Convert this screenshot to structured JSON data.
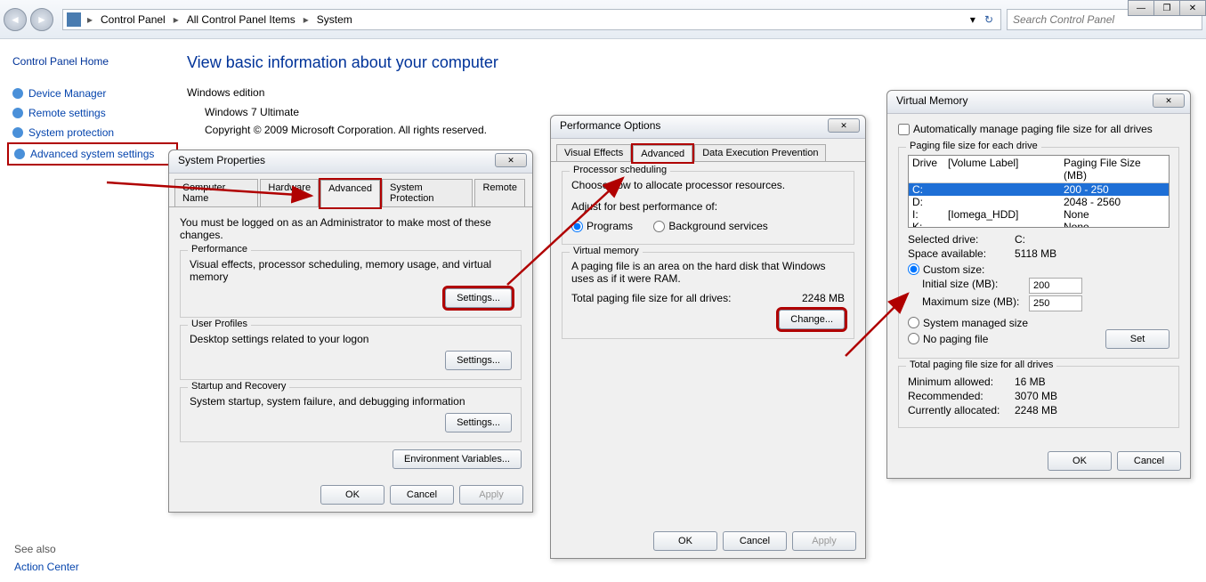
{
  "window_controls": {
    "min": "—",
    "max": "❐",
    "close": "✕"
  },
  "breadcrumb": {
    "items": [
      "Control Panel",
      "All Control Panel Items",
      "System"
    ]
  },
  "search": {
    "placeholder": "Search Control Panel"
  },
  "sidebar": {
    "home": "Control Panel Home",
    "links": [
      "Device Manager",
      "Remote settings",
      "System protection",
      "Advanced system settings"
    ],
    "see_also_hdr": "See also",
    "see_also": [
      "Action Center"
    ]
  },
  "main": {
    "title": "View basic information about your computer",
    "edition_hdr": "Windows edition",
    "edition_name": "Windows 7 Ultimate",
    "copyright": "Copyright © 2009 Microsoft Corporation.  All rights reserved."
  },
  "sysprop": {
    "title": "System Properties",
    "tabs": [
      "Computer Name",
      "Hardware",
      "Advanced",
      "System Protection",
      "Remote"
    ],
    "admin_note": "You must be logged on as an Administrator to make most of these changes.",
    "perf_title": "Performance",
    "perf_desc": "Visual effects, processor scheduling, memory usage, and virtual memory",
    "up_title": "User Profiles",
    "up_desc": "Desktop settings related to your logon",
    "sr_title": "Startup and Recovery",
    "sr_desc": "System startup, system failure, and debugging information",
    "settings_btn": "Settings...",
    "env_btn": "Environment Variables...",
    "ok": "OK",
    "cancel": "Cancel",
    "apply": "Apply"
  },
  "perfopt": {
    "title": "Performance Options",
    "tabs": [
      "Visual Effects",
      "Advanced",
      "Data Execution Prevention"
    ],
    "ps_title": "Processor scheduling",
    "ps_desc": "Choose how to allocate processor resources.",
    "ps_adjust": "Adjust for best performance of:",
    "ps_programs": "Programs",
    "ps_bg": "Background services",
    "vm_title": "Virtual memory",
    "vm_desc": "A paging file is an area on the hard disk that Windows uses as if it were RAM.",
    "vm_total_lbl": "Total paging file size for all drives:",
    "vm_total_val": "2248 MB",
    "change_btn": "Change...",
    "ok": "OK",
    "cancel": "Cancel",
    "apply": "Apply"
  },
  "vmdlg": {
    "title": "Virtual Memory",
    "auto_chk": "Automatically manage paging file size for all drives",
    "pf_title": "Paging file size for each drive",
    "col_drive": "Drive",
    "col_vol": "[Volume Label]",
    "col_pf": "Paging File Size (MB)",
    "rows": [
      {
        "d": "C:",
        "v": "",
        "pf": "200 - 250",
        "sel": true
      },
      {
        "d": "D:",
        "v": "",
        "pf": "2048 - 2560",
        "sel": false
      },
      {
        "d": "I:",
        "v": "[Iomega_HDD]",
        "pf": "None",
        "sel": false
      },
      {
        "d": "K:",
        "v": "",
        "pf": "None",
        "sel": false
      }
    ],
    "sel_drive_lbl": "Selected drive:",
    "sel_drive_val": "C:",
    "space_lbl": "Space available:",
    "space_val": "5118 MB",
    "custom_lbl": "Custom size:",
    "init_lbl": "Initial size (MB):",
    "init_val": "200",
    "max_lbl": "Maximum size (MB):",
    "max_val": "250",
    "sysman_lbl": "System managed size",
    "nopf_lbl": "No paging file",
    "set_btn": "Set",
    "total_hdr": "Total paging file size for all drives",
    "min_lbl": "Minimum allowed:",
    "min_val": "16 MB",
    "rec_lbl": "Recommended:",
    "rec_val": "3070 MB",
    "cur_lbl": "Currently allocated:",
    "cur_val": "2248 MB",
    "ok": "OK",
    "cancel": "Cancel"
  }
}
